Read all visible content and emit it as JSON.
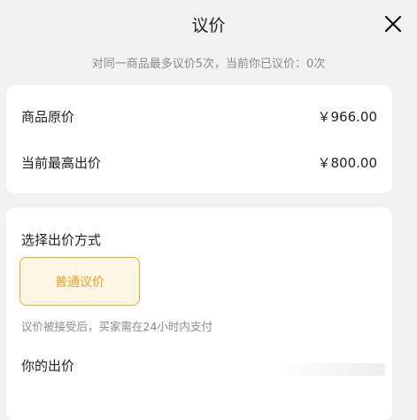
{
  "dialog": {
    "title": "议价",
    "subtitle": "对同一商品最多议价5次，当前你已议价：0次"
  },
  "price_info": {
    "original_label": "商品原价",
    "original_value": "￥966.00",
    "highest_label": "当前最高出价",
    "highest_value": "￥800.00"
  },
  "bid_method": {
    "section_title": "选择出价方式",
    "option_label": "普通议价",
    "hint": "议价被接受后，买家需在24小时内支付"
  },
  "your_bid": {
    "label": "你的出价"
  },
  "colors": {
    "accent": "#f0a020",
    "accent_bg": "#fff6e6",
    "muted_text": "#8a8a8a",
    "page_bg": "#f2f2f2"
  },
  "icons": {
    "close": "close-icon"
  }
}
